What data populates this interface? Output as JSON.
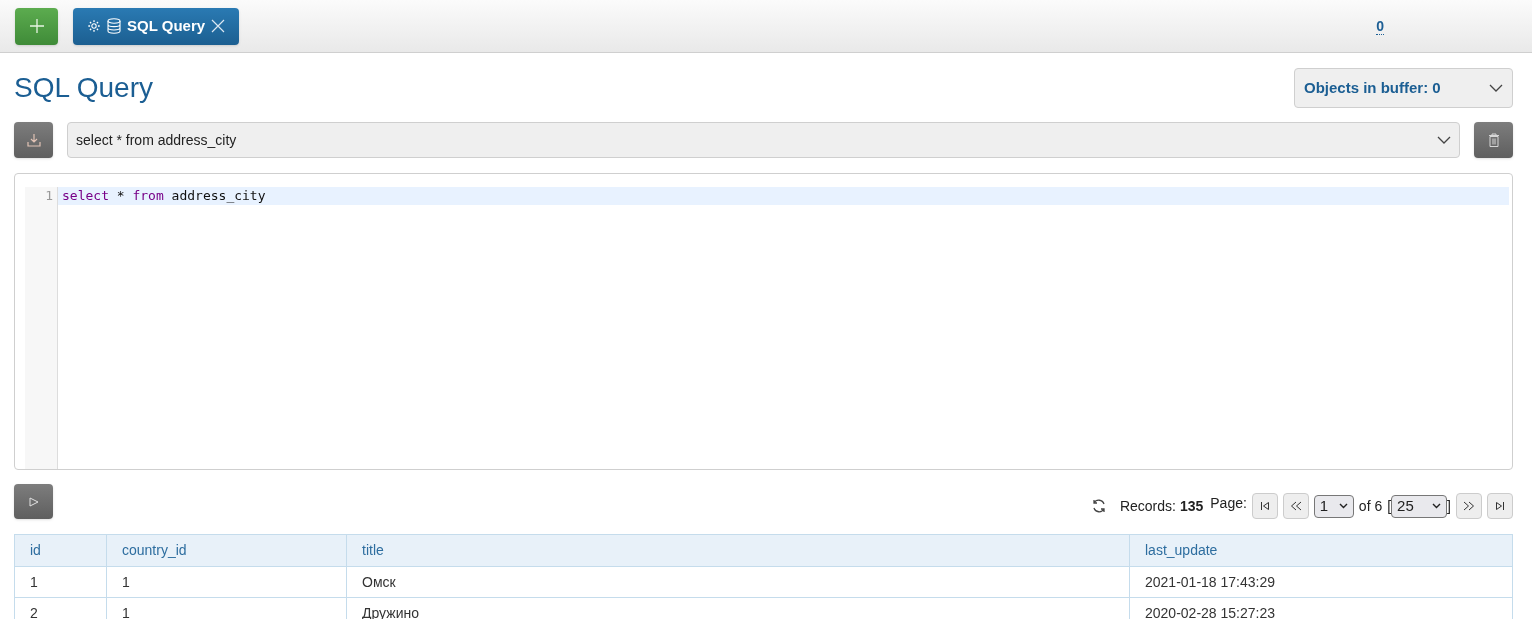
{
  "top_bar": {
    "tab": {
      "label": "SQL Query",
      "selected": true
    },
    "counter": "0"
  },
  "page": {
    "title": "SQL Query",
    "buffer_dropdown": "Objects in buffer: 0"
  },
  "query_select": {
    "value": "select * from address_city"
  },
  "editor": {
    "lines": [
      {
        "number": "1",
        "tokens": [
          {
            "text": "select",
            "kind": "keyword"
          },
          {
            "text": " * ",
            "kind": "plain"
          },
          {
            "text": "from",
            "kind": "keyword"
          },
          {
            "text": " address_city",
            "kind": "plain"
          }
        ]
      }
    ]
  },
  "pager": {
    "records_label": "Records:",
    "records": "135",
    "page_label": "Page:",
    "page": "1",
    "of": "of 6",
    "open_bracket": "[",
    "page_size": "25",
    "close_bracket": "]"
  },
  "table": {
    "columns": [
      "id",
      "country_id",
      "title",
      "last_update"
    ],
    "rows": [
      [
        "1",
        "1",
        "Омск",
        "2021-01-18 17:43:29"
      ],
      [
        "2",
        "1",
        "Дружино",
        "2020-02-28 15:27:23"
      ]
    ]
  }
}
